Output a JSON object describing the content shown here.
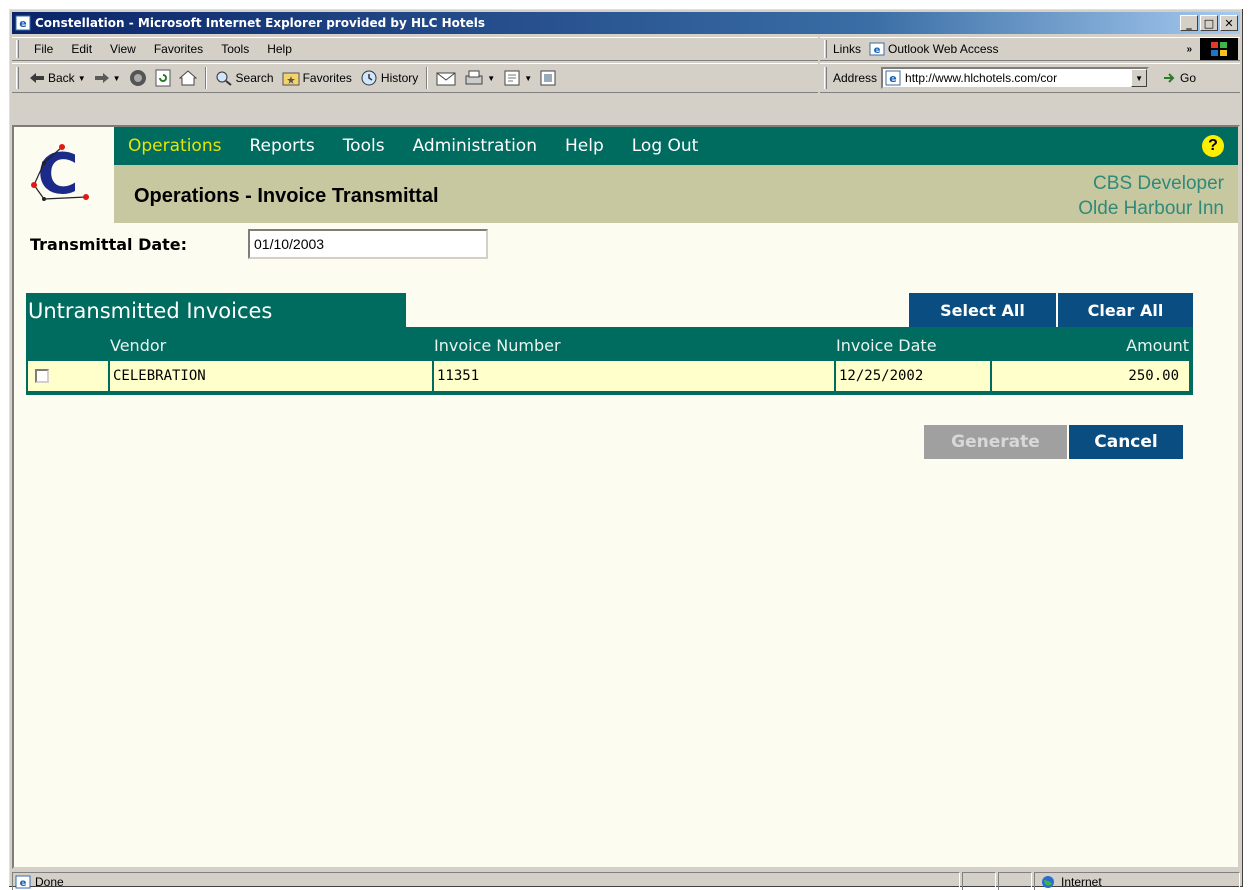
{
  "window": {
    "title": "Constellation - Microsoft Internet Explorer provided by HLC Hotels",
    "controls": [
      "minimize",
      "maximize",
      "close"
    ]
  },
  "menu": {
    "items": [
      "File",
      "Edit",
      "View",
      "Favorites",
      "Tools",
      "Help"
    ]
  },
  "links": {
    "label": "Links",
    "item": "Outlook Web Access",
    "more": "»"
  },
  "toolbar": {
    "back": "Back",
    "search": "Search",
    "favorites": "Favorites",
    "history": "History"
  },
  "address": {
    "label": "Address",
    "url": "http://www.hlchotels.com/cor",
    "go": "Go"
  },
  "app": {
    "nav": [
      "Operations",
      "Reports",
      "Tools",
      "Administration",
      "Help",
      "Log Out"
    ],
    "active_nav": "Operations",
    "page_title": "Operations - Invoice Transmittal",
    "user_name": "CBS Developer",
    "property": "Olde Harbour Inn",
    "help_icon": "?",
    "colors": {
      "nav_bg": "#006b5f",
      "subheader_bg": "#c8c8a0",
      "button_bg": "#0a4d80",
      "row_bg": "#ffffcc"
    }
  },
  "form": {
    "date_label": "Transmittal Date:",
    "date_value": "01/10/2003"
  },
  "invoices": {
    "section_title": "Untransmitted Invoices",
    "select_all": "Select All",
    "clear_all": "Clear All",
    "columns": [
      "Vendor",
      "Invoice Number",
      "Invoice Date",
      "Amount"
    ],
    "rows": [
      {
        "checked": false,
        "vendor": "CELEBRATION",
        "invoice_number": "11351",
        "invoice_date": "12/25/2002",
        "amount": "250.00"
      }
    ]
  },
  "actions": {
    "generate": "Generate",
    "cancel": "Cancel"
  },
  "status": {
    "text": "Done",
    "zone": "Internet"
  }
}
